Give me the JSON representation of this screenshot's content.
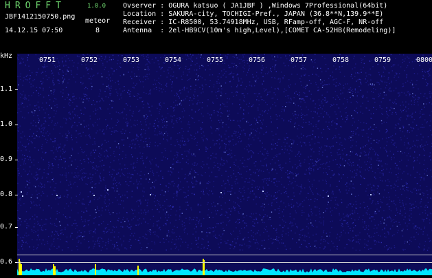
{
  "header": {
    "app_title": "HROFFT",
    "version": "1.0.0",
    "file_name": "JBF1412150750.png",
    "meteor_label": "meteor",
    "meteor_count": "8",
    "datetime": "14.12.15 07:50",
    "observer": "Ovserver : OGURA katsuo ( JA1JBF ) ,Windows 7Professional(64bit)",
    "location": "Location : SAKURA-city, TOCHIGI-Pref., JAPAN (36.8**N,139.9**E)",
    "receiver": "Receiver : IC-R8500, 53.74918MHz, USB, RFamp-off, AGC-F, NR-off",
    "antenna": "Antenna  : 2el-HB9CV(10m's high,Level),[COMET CA-52HB(Remodeling)]"
  },
  "axis": {
    "y_unit": "kHz",
    "y_ticks": [
      "1.1",
      "1.0",
      "0.9",
      "0.8",
      "0.7",
      "0.6"
    ],
    "x_ticks": [
      "0751",
      "0752",
      "0753",
      "0754",
      "0755",
      "0756",
      "0757",
      "0758",
      "0759",
      "0800"
    ]
  },
  "colors": {
    "background": "#0d0b58",
    "spectrum": "#00e5ff",
    "peaks": "#ffff00",
    "title": "#6fd86f"
  }
}
